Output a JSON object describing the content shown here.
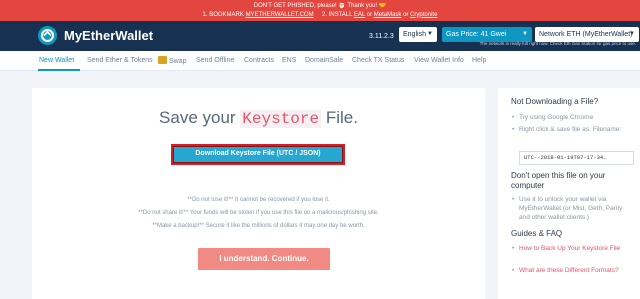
{
  "banner": {
    "line1": "DON'T GET PHISHED, please! 🎅 Thank you! 🤝",
    "line2_prefix": "1. BOOKMARK ",
    "line2_link1": "MYETHERWALLET.COM",
    "line2_mid": "     2. INSTALL ",
    "line2_link2": "EAL",
    "line2_or1": " or ",
    "line2_link3": "MetaMask",
    "line2_or2": " or ",
    "line2_link4": "Cryptonite"
  },
  "header": {
    "brand": "MyEtherWallet",
    "version": "3.11.2.3",
    "language": "English",
    "gas_price": "Gas Price: 41 Gwei",
    "network": "Network ETH (MyEtherWallet)",
    "network_note": "The network is really full right now. Check Eth Gas Station for gas price to use."
  },
  "nav": {
    "items": [
      "New Wallet",
      "Send Ether & Tokens",
      "Swap",
      "Send Offline",
      "Contracts",
      "ENS",
      "DomainSale",
      "Check TX Status",
      "View Wallet Info",
      "Help"
    ]
  },
  "main": {
    "title_prefix": "Save your ",
    "title_code": "Keystore",
    "title_suffix": " File.",
    "download_button": "Download Keystore File (UTC / JSON)",
    "warnings": [
      "**Do not lose it!** It cannot be recovered if you lose it.",
      "**Do not share it!** Your funds will be stolen if you use this file on a malicious/phishing site.",
      "**Make a backup!** Secure it like the millions of dollars it may one day be worth."
    ],
    "continue_button": "I understand. Continue."
  },
  "sidebar": {
    "heading1": "Not Downloading a File?",
    "item1": "Try using Google Chrome",
    "item2": "Right click & save file as. Filename:",
    "filename": "UTC--2018-01-19T07-17-34.",
    "heading2": "Don't open this file on your computer",
    "item3": "Use it to unlock your wallet via MyEtherWallet (or Mist, Geth, Parity and other wallet clients.)",
    "heading3": "Guides & FAQ",
    "link1": "How to Back Up Your Keystore File",
    "link2": "What are these Different Formats?"
  },
  "colors": {
    "banner": "#e2463f",
    "header": "#163151",
    "accent": "#0e97c0",
    "highlight_border": "#d31f27",
    "continue_button": "#f08a82"
  }
}
